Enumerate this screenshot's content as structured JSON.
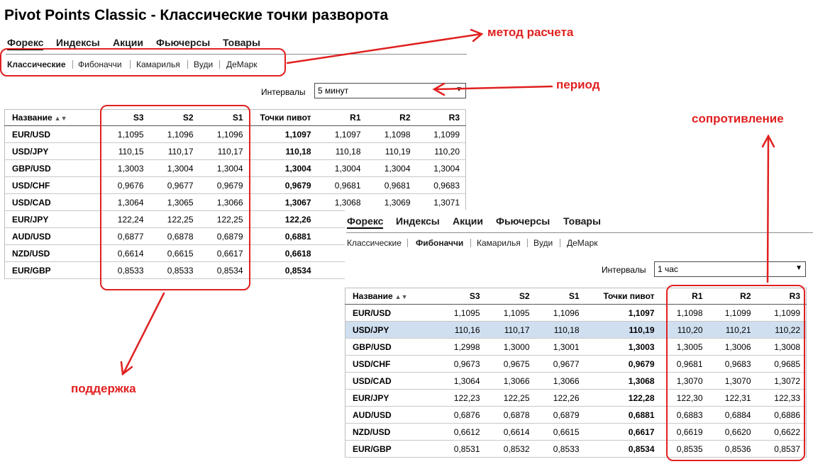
{
  "title": "Pivot Points Classic - Классические точки разворота",
  "tabs": [
    "Форекс",
    "Индексы",
    "Акции",
    "Фьючерсы",
    "Товары"
  ],
  "methods": [
    "Классические",
    "Фибоначчи",
    "Камарилья",
    "Вуди",
    "ДеМарк"
  ],
  "interval_label": "Интервалы",
  "columns": [
    "Название",
    "S3",
    "S2",
    "S1",
    "Точки пивот",
    "R1",
    "R2",
    "R3"
  ],
  "widget1": {
    "active_method": "Классические",
    "interval": "5 минут",
    "rows": [
      [
        "EUR/USD",
        "1,1095",
        "1,1096",
        "1,1096",
        "1,1097",
        "1,1097",
        "1,1098",
        "1,1099"
      ],
      [
        "USD/JPY",
        "110,15",
        "110,17",
        "110,17",
        "110,18",
        "110,18",
        "110,19",
        "110,20"
      ],
      [
        "GBP/USD",
        "1,3003",
        "1,3004",
        "1,3004",
        "1,3004",
        "1,3004",
        "1,3004",
        "1,3004"
      ],
      [
        "USD/CHF",
        "0,9676",
        "0,9677",
        "0,9679",
        "0,9679",
        "0,9681",
        "0,9681",
        "0,9683"
      ],
      [
        "USD/CAD",
        "1,3064",
        "1,3065",
        "1,3066",
        "1,3067",
        "1,3068",
        "1,3069",
        "1,3071"
      ],
      [
        "EUR/JPY",
        "122,24",
        "122,25",
        "122,25",
        "122,26",
        "",
        "",
        ""
      ],
      [
        "AUD/USD",
        "0,6877",
        "0,6878",
        "0,6879",
        "0,6881",
        "",
        "",
        ""
      ],
      [
        "NZD/USD",
        "0,6614",
        "0,6615",
        "0,6617",
        "0,6618",
        "",
        "",
        ""
      ],
      [
        "EUR/GBP",
        "0,8533",
        "0,8533",
        "0,8534",
        "0,8534",
        "",
        "",
        ""
      ]
    ]
  },
  "widget2": {
    "active_method": "Фибоначчи",
    "interval": "1 час",
    "highlighted_row": "USD/JPY",
    "rows": [
      [
        "EUR/USD",
        "1,1095",
        "1,1095",
        "1,1096",
        "1,1097",
        "1,1098",
        "1,1099",
        "1,1099"
      ],
      [
        "USD/JPY",
        "110,16",
        "110,17",
        "110,18",
        "110,19",
        "110,20",
        "110,21",
        "110,22"
      ],
      [
        "GBP/USD",
        "1,2998",
        "1,3000",
        "1,3001",
        "1,3003",
        "1,3005",
        "1,3006",
        "1,3008"
      ],
      [
        "USD/CHF",
        "0,9673",
        "0,9675",
        "0,9677",
        "0,9679",
        "0,9681",
        "0,9683",
        "0,9685"
      ],
      [
        "USD/CAD",
        "1,3064",
        "1,3066",
        "1,3066",
        "1,3068",
        "1,3070",
        "1,3070",
        "1,3072"
      ],
      [
        "EUR/JPY",
        "122,23",
        "122,25",
        "122,26",
        "122,28",
        "122,30",
        "122,31",
        "122,33"
      ],
      [
        "AUD/USD",
        "0,6876",
        "0,6878",
        "0,6879",
        "0,6881",
        "0,6883",
        "0,6884",
        "0,6886"
      ],
      [
        "NZD/USD",
        "0,6612",
        "0,6614",
        "0,6615",
        "0,6617",
        "0,6619",
        "0,6620",
        "0,6622"
      ],
      [
        "EUR/GBP",
        "0,8531",
        "0,8532",
        "0,8533",
        "0,8534",
        "0,8535",
        "0,8536",
        "0,8537"
      ]
    ]
  },
  "annotations": {
    "method": "метод расчета",
    "period": "период",
    "resistance": "сопротивление",
    "support": "поддержка",
    "color": "#e02020"
  },
  "colors": {
    "highlight_row": "#cfdff0",
    "annotation": "#e02020"
  }
}
